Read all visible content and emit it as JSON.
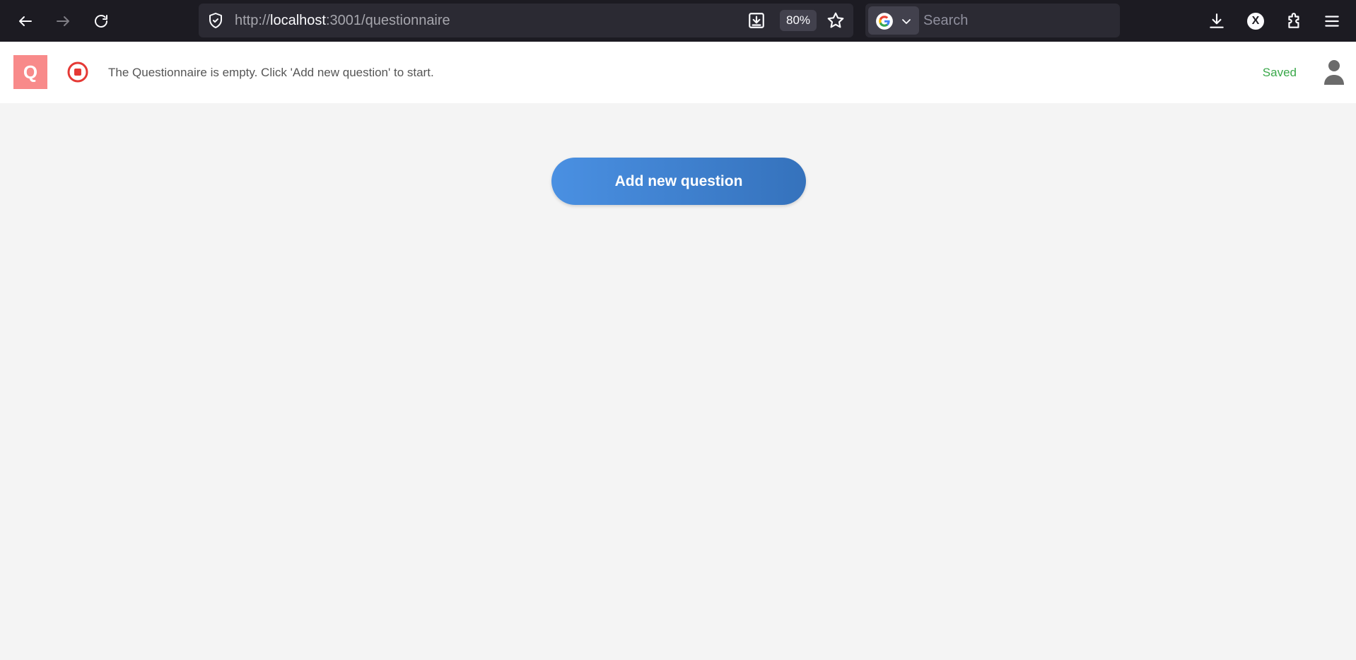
{
  "browser": {
    "url_scheme": "http://",
    "url_host": "localhost",
    "url_rest": ":3001/questionnaire",
    "zoom": "80%",
    "search_placeholder": "Search",
    "extension_label": "X"
  },
  "header": {
    "logo_letter": "Q",
    "status_message": "The Questionnaire is empty. Click 'Add new question' to start.",
    "save_status": "Saved"
  },
  "main": {
    "add_question_label": "Add new question"
  },
  "colors": {
    "logo_bg": "#f88a8a",
    "stop_icon": "#e53935",
    "saved_text": "#3aa84a",
    "button_start": "#4a90e2",
    "button_end": "#3572bc"
  }
}
